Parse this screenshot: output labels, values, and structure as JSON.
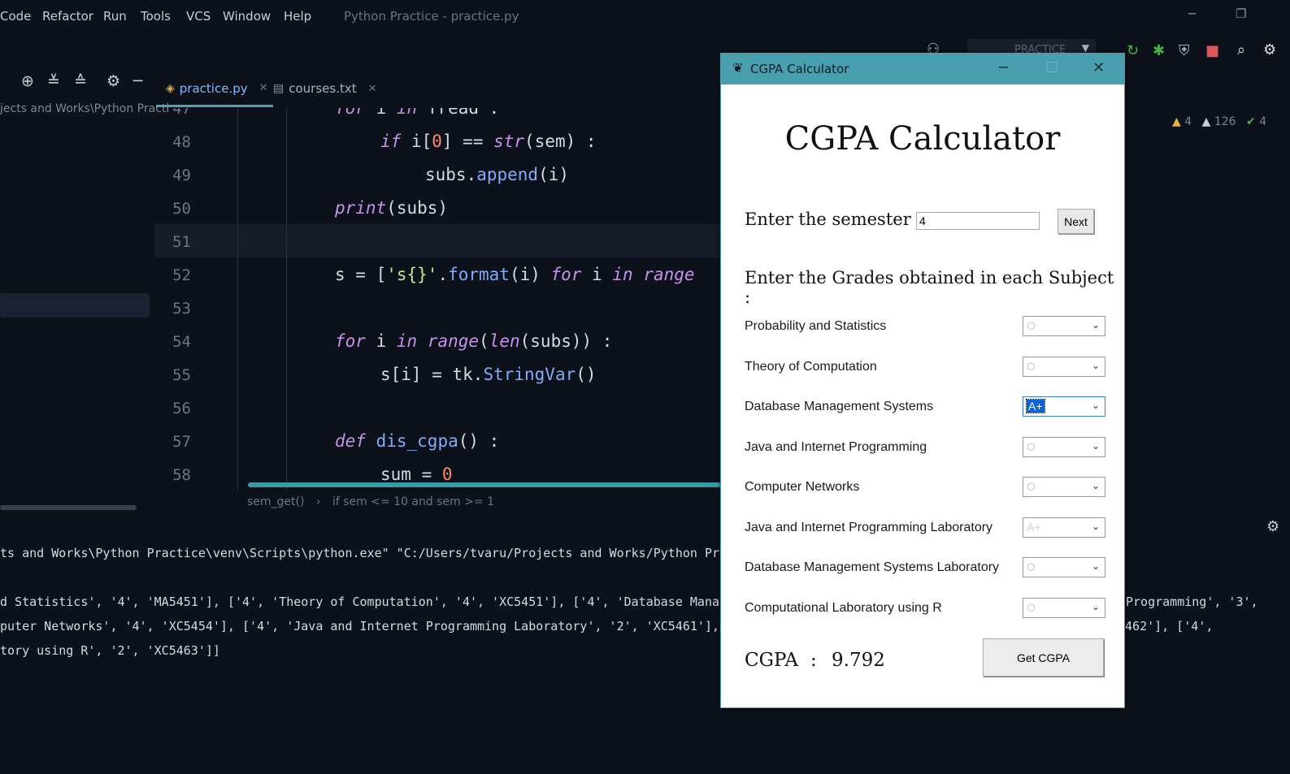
{
  "menubar": {
    "items": [
      {
        "label": "Code"
      },
      {
        "label": "Refactor"
      },
      {
        "label": "Run"
      },
      {
        "label": "Tools"
      },
      {
        "label": "VCS"
      },
      {
        "label": "Window"
      },
      {
        "label": "Help"
      }
    ],
    "window_title": "Python Practice - practice.py"
  },
  "runbar": {
    "config_label": "PRACTICE"
  },
  "tabs": [
    {
      "label": "practice.py",
      "active": true
    },
    {
      "label": "courses.txt",
      "active": false
    }
  ],
  "project": {
    "path": "jects and Works\\Python Practi"
  },
  "editor": {
    "line_numbers": [
      "47",
      "48",
      "49",
      "50",
      "51",
      "52",
      "53",
      "54",
      "55",
      "56",
      "57",
      "58"
    ],
    "inspections": {
      "warnings": "4",
      "weak_warnings": "126",
      "ok": "4"
    }
  },
  "breadcrumb": {
    "func": "sem_get()",
    "cond": "if sem <= 10 and sem >= 1"
  },
  "console": {
    "lines": [
      "ts and Works\\Python Practice\\venv\\Scripts\\python.exe\" \"C:/Users/tvaru/Projects and Works/Python Prac",
      "d Statistics', '4', 'MA5451'], ['4', 'Theory of Computation', '4', 'XC5451'], ['4', 'Database Manage",
      "puter Networks', '4', 'XC5454'], ['4', 'Java and Internet Programming Laboratory', '2', 'XC5461'], [",
      "tory using R', '2', 'XC5463']]"
    ],
    "lines_right": [
      "Programming', '3',",
      "5462'], ['4',"
    ]
  },
  "dialog": {
    "window_title": "CGPA Calculator",
    "heading": "CGPA Calculator",
    "semester_label": "Enter the semester :",
    "semester_value": "4",
    "next_label": "Next",
    "grades_label": "Enter the Grades obtained in each Subject :",
    "subjects": [
      {
        "name": "Probability and Statistics",
        "grade": "O"
      },
      {
        "name": "Theory of Computation",
        "grade": "O"
      },
      {
        "name": "Database Management Systems",
        "grade": "A+"
      },
      {
        "name": "Java and Internet Programming",
        "grade": "O"
      },
      {
        "name": "Computer Networks",
        "grade": "O"
      },
      {
        "name": "Java and Internet Programming Laboratory",
        "grade": "A+"
      },
      {
        "name": "Database Management Systems Laboratory",
        "grade": "O"
      },
      {
        "name": "Computational Laboratory using R",
        "grade": "O"
      }
    ],
    "cgpa_label": "CGPA",
    "cgpa_colon": ":",
    "cgpa_value": "9.792",
    "get_label": "Get CGPA"
  },
  "colors": {
    "accent": "#4a9fae",
    "background": "#0d111a"
  }
}
